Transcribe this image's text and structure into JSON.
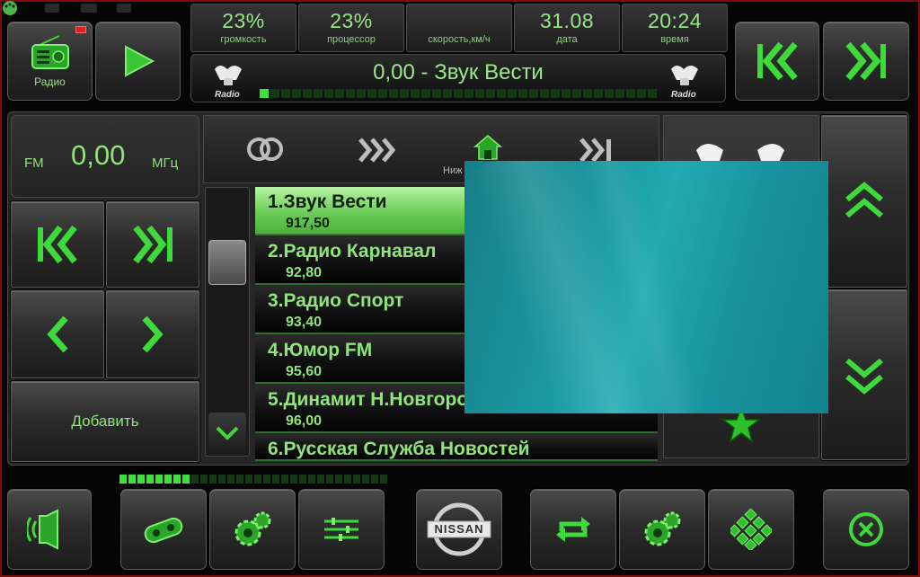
{
  "source_button": {
    "label": "Радио",
    "icon": "radio-icon"
  },
  "stats": [
    {
      "value": "23%",
      "label": "громкость"
    },
    {
      "value": "23%",
      "label": "процессор"
    },
    {
      "value": "",
      "label": "скорость,км/ч"
    },
    {
      "value": "31.08",
      "label": "дата"
    },
    {
      "value": "20:24",
      "label": "время"
    }
  ],
  "now_playing": {
    "title": "0,00 - Звук Вести",
    "logo_label": "Radio",
    "level_fraction": 0.04
  },
  "tuner": {
    "band": "FM",
    "frequency": "0,00",
    "unit": "МГц"
  },
  "add_button_label": "Добавить",
  "tabs": {
    "home_label": "Ниж"
  },
  "stations": [
    {
      "name": "1.Звук Вести",
      "freq": "917,50",
      "active": true
    },
    {
      "name": "2.Радио Карнавал",
      "freq": "92,80",
      "active": false
    },
    {
      "name": "3.Радио Спорт",
      "freq": "93,40",
      "active": false
    },
    {
      "name": "4.Юмор FM",
      "freq": "95,60",
      "active": false
    },
    {
      "name": "5.Динамит Н.Новгород",
      "freq": "96,00",
      "active": false
    },
    {
      "name": "6.Русская Служба Новостей",
      "freq": "",
      "active": false
    }
  ],
  "brand": {
    "logo_text": "NISSAN"
  },
  "colors": {
    "accent": "#3ed93a",
    "active_row": "#6ccd58",
    "frame_border": "#7a0d0d",
    "overlay": "#1a9aa2"
  },
  "bottom_level_fraction": 0.27
}
